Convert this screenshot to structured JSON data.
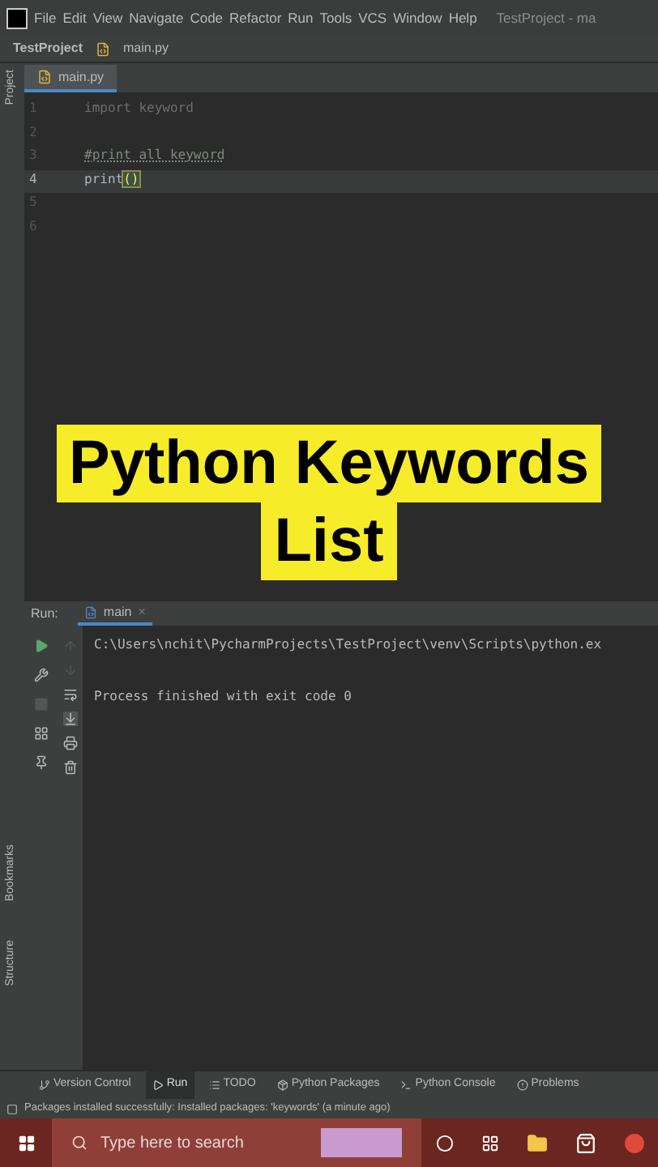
{
  "menu": [
    "File",
    "Edit",
    "View",
    "Navigate",
    "Code",
    "Refactor",
    "Run",
    "Tools",
    "VCS",
    "Window",
    "Help"
  ],
  "window": {
    "title": "TestProject - ma"
  },
  "breadcrumb": {
    "project": "TestProject",
    "file": "main.py"
  },
  "editor_tabs": [
    {
      "label": "main.py",
      "selected": true
    }
  ],
  "left_strip": {
    "top": [
      "Project"
    ],
    "bottom": [
      "Bookmarks",
      "Structure"
    ]
  },
  "code_lines": [
    {
      "number": "1",
      "text": "import keyword",
      "kind": "dim",
      "current": false
    },
    {
      "number": "2",
      "current": false
    },
    {
      "number": "3",
      "text": "#print all keyword",
      "kind": "comment",
      "current": false
    },
    {
      "number": "4",
      "text": "print",
      "kind": "call",
      "current": true,
      "paren_open": "(",
      "paren_close": ")"
    },
    {
      "number": "5",
      "current": false
    },
    {
      "number": "6",
      "current": false
    }
  ],
  "overlay": {
    "lines": [
      "Python Keywords",
      "List"
    ]
  },
  "run": {
    "label": "Run:",
    "tab": "main",
    "close": "×",
    "output": [
      "C:\\Users\\nchit\\PycharmProjects\\TestProject\\venv\\Scripts\\python.ex",
      "Process finished with exit code 0"
    ]
  },
  "tool_tabs": [
    {
      "label": "Version Control",
      "kind": "vcs",
      "selected": false
    },
    {
      "label": "Run",
      "kind": "run",
      "selected": true
    },
    {
      "label": "TODO",
      "kind": "todo",
      "selected": false
    },
    {
      "label": "Python Packages",
      "kind": "packages",
      "selected": false
    },
    {
      "label": "Python Console",
      "kind": "console",
      "selected": false
    },
    {
      "label": "Problems",
      "kind": "problems",
      "selected": false
    }
  ],
  "status_bar": "Packages installed successfully: Installed packages: 'keywords' (a minute ago)",
  "taskbar": {
    "search_placeholder": "Type here to search"
  }
}
